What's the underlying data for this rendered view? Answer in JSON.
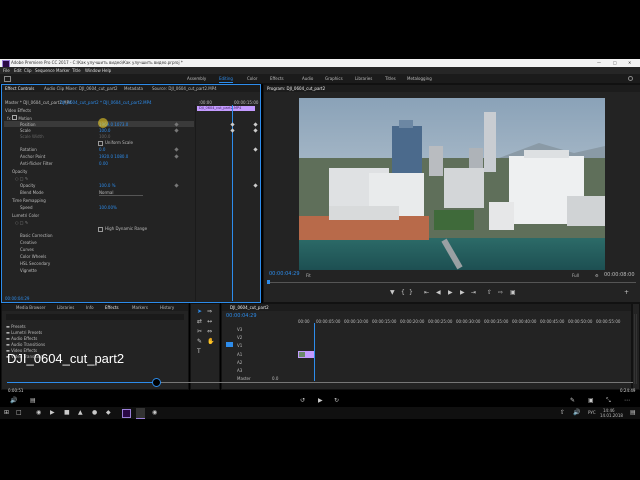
{
  "app": {
    "title": "Adobe Premiere Pro CC 2017 - C:\\Как улучшить видео\\Как улучшить видео.prproj *",
    "menu": [
      "File",
      "Edit",
      "Clip",
      "Sequence",
      "Marker",
      "Title",
      "Window",
      "Help"
    ],
    "workspaces": [
      "Assembly",
      "Editing",
      "Color",
      "Effects",
      "Audio",
      "Graphics",
      "Libraries",
      "Titles",
      "Metalogging"
    ],
    "active_workspace": "Editing"
  },
  "effect_controls": {
    "tabs": [
      "Effect Controls",
      "Audio Clip Mixer: DJI_0604_cut_part2",
      "Metadata",
      "Source: DJI_0604_cut_part2.MP4"
    ],
    "master_label": "Master * DJI_0604_cut_part2.MP4",
    "seq_label": "DJI_0604_cut_part2 * DJI_0604_cut_part2.MP4",
    "ruler_start": ":00:00",
    "ruler_end": "00:00:15:00",
    "clip_name": "DJI_0604_cut_part2.MP4",
    "section": "Video Effects",
    "rows": [
      {
        "name": "Motion",
        "value": ""
      },
      {
        "name": "Position",
        "value": "1969.0   1073.0"
      },
      {
        "name": "Scale",
        "value": "100.0"
      },
      {
        "name": "Scale Width",
        "value": "100.0"
      },
      {
        "name": "Uniform Scale",
        "value": ""
      },
      {
        "name": "Rotation",
        "value": "0.0"
      },
      {
        "name": "Anchor Point",
        "value": "1920.0   1080.0"
      },
      {
        "name": "Anti-flicker Filter",
        "value": "0.00"
      },
      {
        "name": "Opacity",
        "value": ""
      },
      {
        "name": "Opacity",
        "value": "100.0 %"
      },
      {
        "name": "Blend Mode",
        "value": "Normal"
      },
      {
        "name": "Time Remapping",
        "value": ""
      },
      {
        "name": "Speed",
        "value": "100.00%"
      },
      {
        "name": "Lumetri Color",
        "value": ""
      },
      {
        "name": "High Dynamic Range",
        "value": ""
      },
      {
        "name": "Basic Correction",
        "value": ""
      },
      {
        "name": "Creative",
        "value": ""
      },
      {
        "name": "Curves",
        "value": ""
      },
      {
        "name": "Color Wheels",
        "value": ""
      },
      {
        "name": "HSL Secondary",
        "value": ""
      },
      {
        "name": "Vignette",
        "value": ""
      }
    ],
    "footer_time": "00:00:04:29"
  },
  "program": {
    "tab": "Program: DJI_0604_cut_part2",
    "timecode": "00:00:04:29",
    "fit": "Fit",
    "quality": "Full",
    "duration": "00:00:08:00"
  },
  "project": {
    "tabs": [
      "Media Browser",
      "Libraries",
      "Info",
      "Effects",
      "Markers",
      "History"
    ],
    "items": [
      "Presets",
      "Lumetri Presets",
      "Audio Effects",
      "Audio Transitions",
      "Video Effects",
      "Video Transitions"
    ]
  },
  "timeline": {
    "tab": "DJI_0604_cut_part2",
    "timecode": "00:00:04:29",
    "ruler": [
      "00:00",
      "00:00:05:00",
      "00:00:10:00",
      "00:00:15:00",
      "00:00:20:00",
      "00:00:25:00",
      "00:00:30:00",
      "00:00:35:00",
      "00:00:40:00",
      "00:00:45:00",
      "00:00:50:00",
      "00:00:55:00"
    ],
    "tracks": [
      "V3",
      "V2",
      "V1",
      "A1",
      "A2",
      "A3",
      "Master"
    ],
    "master_value": "0.0"
  },
  "player": {
    "caption": "DJI_0604_cut_part2",
    "current": "0:00:51",
    "total": "0:24:49",
    "progress": 0.24
  },
  "taskbar": {
    "lang": "РУС",
    "time": "14:46",
    "date": "14.01.2018"
  }
}
